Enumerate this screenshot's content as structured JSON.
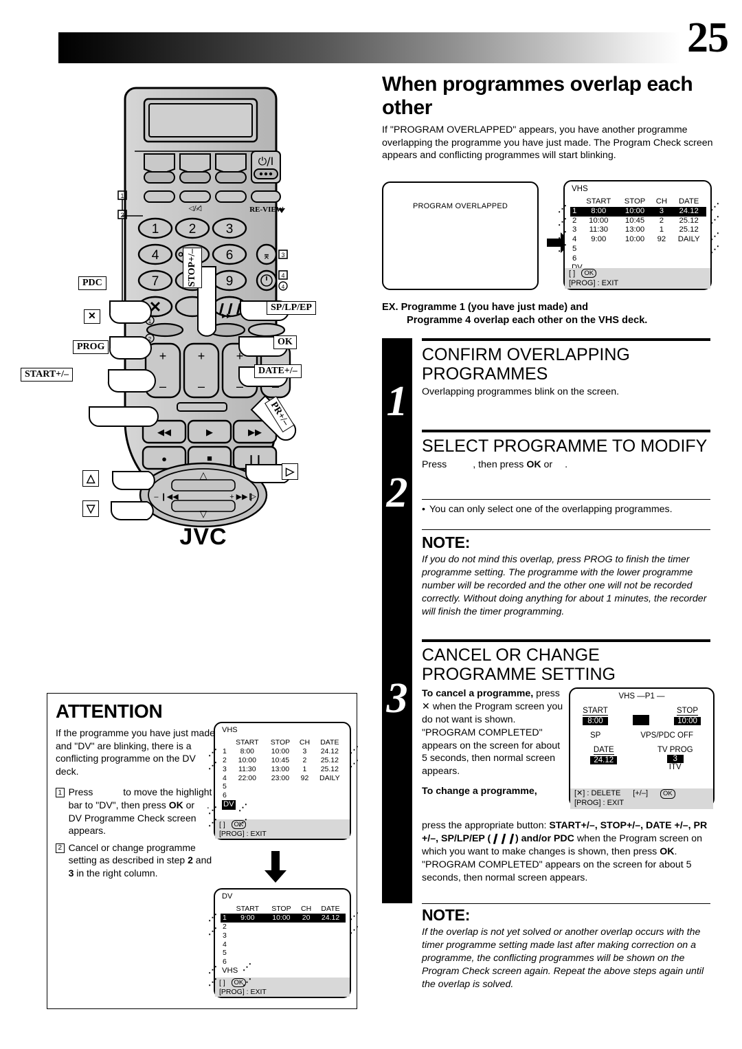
{
  "page": {
    "number": "25"
  },
  "main": {
    "title": "When programmes overlap each other",
    "intro": "If \"PROGRAM OVERLAPPED\" appears, you have another programme overlapping the programme you have just made. The Program Check screen appears and conflicting programmes will start blinking.",
    "example_line1": "EX. Programme 1 (you have just made) and",
    "example_line2": "Programme 4 overlap each other on the VHS deck."
  },
  "overlapped_screen": {
    "message": "PROGRAM OVERLAPPED"
  },
  "vhs_check_screen": {
    "deck": "VHS",
    "columns": [
      "START",
      "STOP",
      "CH",
      "DATE"
    ],
    "rows": [
      {
        "no": "1",
        "start": "8:00",
        "stop": "10:00",
        "ch": "3",
        "date": "24.12",
        "highlight": true
      },
      {
        "no": "2",
        "start": "10:00",
        "stop": "10:45",
        "ch": "2",
        "date": "25.12",
        "highlight": false
      },
      {
        "no": "3",
        "start": "11:30",
        "stop": "13:00",
        "ch": "1",
        "date": "25.12",
        "highlight": false
      },
      {
        "no": "4",
        "start": "9:00",
        "stop": "10:00",
        "ch": "92",
        "date": "DAILY",
        "highlight": false
      },
      {
        "no": "5",
        "start": "",
        "stop": "",
        "ch": "",
        "date": "",
        "highlight": false
      },
      {
        "no": "6",
        "start": "",
        "stop": "",
        "ch": "",
        "date": "",
        "highlight": false
      }
    ],
    "other_deck": "DV",
    "footer_line1": "[    ]      OK",
    "footer_ok": "OK",
    "footer_brackets": "[    ]",
    "footer_line2": "[PROG] : EXIT"
  },
  "steps": [
    {
      "number": "1",
      "title": "CONFIRM OVERLAPPING PROGRAMMES",
      "text": "Overlapping programmes blink on the screen."
    },
    {
      "number": "2",
      "title": "SELECT PROGRAMME TO MODIFY",
      "text_before": "Press",
      "text_middle": ", then press",
      "ok_label": "OK",
      "text_or": "or",
      "text_end": ".",
      "bullet": "You can only select one of the overlapping programmes."
    },
    {
      "number": "3",
      "title": "CANCEL OR CHANGE PROGRAMME SETTING",
      "cancel_head": "To cancel a programme,",
      "cancel_text": "press ✕ when the Program screen you do not want is shown. \"PROGRAM COMPLETED\" appears on the screen for about 5 seconds, then normal screen appears.",
      "change_head": "To change a programme,",
      "change_text_1": "press the appropriate button: ",
      "change_buttons": "START+/–, STOP+/–, DATE +/–, PR +/–, SP/LP/EP (",
      "change_buttons_2": ") and/or ",
      "pdc_label": "PDC",
      "change_text_2": " when the Program screen on which you want to make changes is shown, then press ",
      "ok_label": "OK",
      "change_text_3": ".",
      "change_text_4": "\"PROGRAM COMPLETED\" appears on the screen for about 5 seconds, then normal screen appears."
    }
  ],
  "note_1": {
    "head": "NOTE:",
    "body": "If you do not mind this overlap, press PROG to finish the timer programme setting. The programme with the lower programme number will be recorded and the other one will not be recorded correctly. Without doing anything for about 1 minutes, the recorder will finish the timer programming.",
    "bold_term": "PROG"
  },
  "note_2": {
    "head": "NOTE:",
    "body": "If the overlap is not yet solved or another overlap occurs with the timer programme setting made last after making correction on a programme, the conflicting programmes will be shown on the Program Check screen again. Repeat the above steps again until the overlap is solved."
  },
  "program_screen": {
    "title": "VHS —P1 —",
    "start_label": "START",
    "start_value": "8:00",
    "stop_label": "STOP",
    "stop_value": "10:00",
    "speed": "SP",
    "vps": "VPS/PDC OFF",
    "date_label": "DATE",
    "date_value": "24.12",
    "tvprog_label": "TV PROG",
    "tvprog_value": "3",
    "station": "ITV",
    "footer_delete": "[✕] : DELETE",
    "footer_plusminus": "[+/–]",
    "footer_ok": "OK",
    "footer_exit": "[PROG] : EXIT"
  },
  "attention": {
    "title": "ATTENTION",
    "intro": "If the programme you have just made and \"DV\" are blinking, there is a conflicting programme on the DV deck.",
    "items": [
      {
        "num": "1",
        "text_a": "Press",
        "text_b": "to move the highlight bar to \"DV\", then press",
        "ok_label": "OK",
        "text_c": "or",
        "text_d": ".",
        "text_e": "DV Programme Check screen appears."
      },
      {
        "num": "2",
        "text_a": "Cancel or change programme setting as described in step",
        "step_a": "2",
        "text_and": "and",
        "step_b": "3",
        "text_b": "in the right column."
      }
    ],
    "vhs_screen": {
      "deck": "VHS",
      "columns": [
        "START",
        "STOP",
        "CH",
        "DATE"
      ],
      "rows": [
        {
          "no": "1",
          "start": "8:00",
          "stop": "10:00",
          "ch": "3",
          "date": "24.12",
          "highlight": false
        },
        {
          "no": "2",
          "start": "10:00",
          "stop": "10:45",
          "ch": "2",
          "date": "25.12",
          "highlight": false
        },
        {
          "no": "3",
          "start": "11:30",
          "stop": "13:00",
          "ch": "1",
          "date": "25.12",
          "highlight": false
        },
        {
          "no": "4",
          "start": "22:00",
          "stop": "23:00",
          "ch": "92",
          "date": "DAILY",
          "highlight": false
        },
        {
          "no": "5",
          "start": "",
          "stop": "",
          "ch": "",
          "date": "",
          "highlight": false
        },
        {
          "no": "6",
          "start": "",
          "stop": "",
          "ch": "",
          "date": "",
          "highlight": false
        }
      ],
      "other_deck": "DV",
      "other_deck_highlight": true,
      "footer_brackets": "[    ]",
      "footer_ok": "OK",
      "footer_line2": "[PROG] : EXIT"
    },
    "dv_screen": {
      "deck": "DV",
      "columns": [
        "START",
        "STOP",
        "CH",
        "DATE"
      ],
      "rows": [
        {
          "no": "1",
          "start": "9:00",
          "stop": "10:00",
          "ch": "20",
          "date": "24.12",
          "highlight": true
        },
        {
          "no": "2",
          "start": "",
          "stop": "",
          "ch": "",
          "date": "",
          "highlight": false
        },
        {
          "no": "3",
          "start": "",
          "stop": "",
          "ch": "",
          "date": "",
          "highlight": false
        },
        {
          "no": "4",
          "start": "",
          "stop": "",
          "ch": "",
          "date": "",
          "highlight": false
        },
        {
          "no": "5",
          "start": "",
          "stop": "",
          "ch": "",
          "date": "",
          "highlight": false
        },
        {
          "no": "6",
          "start": "",
          "stop": "",
          "ch": "",
          "date": "",
          "highlight": false
        }
      ],
      "other_deck": "VHS",
      "other_deck_highlight": false,
      "footer_brackets": "[    ]",
      "footer_ok": "OK",
      "footer_line2": "[PROG] : EXIT"
    }
  },
  "remote": {
    "brand": "JVC",
    "callouts": {
      "pdc": "PDC",
      "cancel": "✕",
      "prog": "PROG",
      "start": "START+/–",
      "stop": "STOP+/–",
      "splpep": "SP/LP/EP",
      "ok": "OK",
      "date": "DATE+/–",
      "pr": "PR+/–",
      "up": "△",
      "down": "▽",
      "right": "▷"
    },
    "keys": {
      "k1": "1",
      "k2": "2",
      "k3": "3",
      "k4": "4",
      "k5": "5",
      "k6": "6",
      "k7": "7",
      "k8": "8",
      "k9": "9",
      "review": "RE-VIEW",
      "power": "⏻/I"
    },
    "markers": {
      "m1": "1",
      "m2": "2",
      "m3": "3",
      "m4": "4"
    }
  }
}
